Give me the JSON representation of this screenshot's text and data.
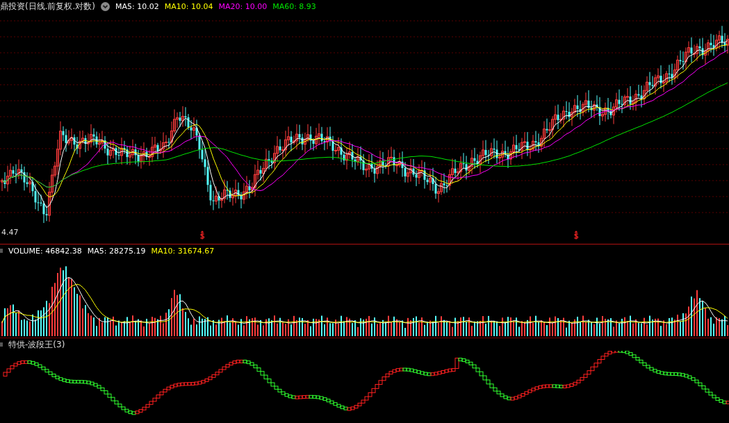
{
  "price_panel": {
    "title": "鼎投资(日线.前复权.对数)",
    "indicators": [
      {
        "label": "MA5: 10.02",
        "color": "#ffffff"
      },
      {
        "label": "MA10: 10.04",
        "color": "#ffff00"
      },
      {
        "label": "MA20: 10.00",
        "color": "#ff00ff"
      },
      {
        "label": "MA60: 8.93",
        "color": "#00e600"
      }
    ],
    "low_label": "4.47"
  },
  "volume_panel": {
    "indicators": [
      {
        "label": "VOLUME: 46842.38",
        "color": "#ffffff"
      },
      {
        "label": "MA5: 28275.19",
        "color": "#ffffff"
      },
      {
        "label": "MA10: 31674.67",
        "color": "#ffff00"
      }
    ]
  },
  "wave_panel": {
    "title": "特供-波段王(3)"
  }
}
